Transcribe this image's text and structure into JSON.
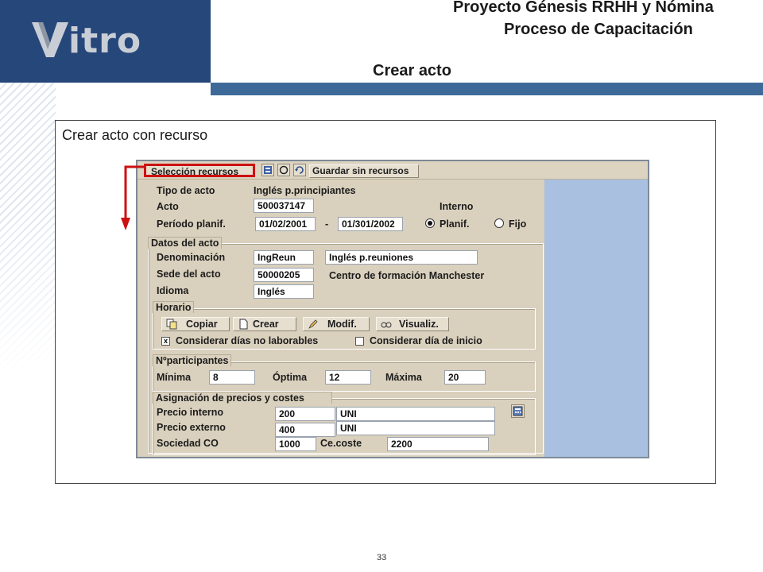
{
  "header": {
    "logo_text": "itro",
    "logo_brand": "Vitro",
    "title_line1": "Proyecto Génesis RRHH y Nómina",
    "title_line2": "Proceso de Capacitación",
    "slide_title": "Crear acto"
  },
  "frame": {
    "caption": "Crear acto con recurso"
  },
  "toolbar": {
    "seleccion_recursos": "Selección recursos",
    "guardar_sin_recursos": "Guardar sin recursos"
  },
  "form": {
    "tipo_de_acto_label": "Tipo de acto",
    "tipo_de_acto_value": "Inglés p.principiantes",
    "acto_label": "Acto",
    "acto_value": "500037147",
    "interno_label": "Interno",
    "periodo_label": "Período planif.",
    "periodo_from": "01/02/2001",
    "periodo_sep": "-",
    "periodo_to": "01/301/2002",
    "planif_label": "Planif.",
    "fijo_label": "Fijo",
    "planif_selected": true
  },
  "datos": {
    "title": "Datos del acto",
    "denominacion_label": "Denominación",
    "denominacion_value": "IngReun",
    "denominacion_text": "Inglés p.reuniones",
    "sede_label": "Sede del acto",
    "sede_value": "50000205",
    "sede_text": "Centro de formación Manchester",
    "idioma_label": "Idioma",
    "idioma_value": "Inglés"
  },
  "horario": {
    "title": "Horario",
    "copiar": "Copiar",
    "crear": "Crear",
    "modif": "Modif.",
    "visualiz": "Visualiz.",
    "no_laborables_label": "Considerar días no laborables",
    "no_laborables_mark": "x",
    "dia_inicio_label": "Considerar día de inicio"
  },
  "participantes": {
    "title": "Nºparticipantes",
    "minima_label": "Mínima",
    "minima_value": "8",
    "optima_label": "Óptima",
    "optima_value": "12",
    "maxima_label": "Máxima",
    "maxima_value": "20"
  },
  "precios": {
    "title": "Asignación de precios y costes",
    "interno_label": "Precio interno",
    "interno_value": "200",
    "interno_unit": "UNI",
    "externo_label": "Precio externo",
    "externo_value": "400",
    "externo_unit": "UNI",
    "sociedad_label": "Sociedad CO",
    "sociedad_value": "1000",
    "cecoste_label": "Ce.coste",
    "cecoste_value": "2200"
  },
  "footer": {
    "page_number": "33"
  },
  "colors": {
    "brand_blue": "#26477a",
    "bar_blue": "#3e6a9a",
    "highlight_red": "#cc1111",
    "sap_panel": "#d9d0bd",
    "sap_background": "#a9c0e0"
  }
}
